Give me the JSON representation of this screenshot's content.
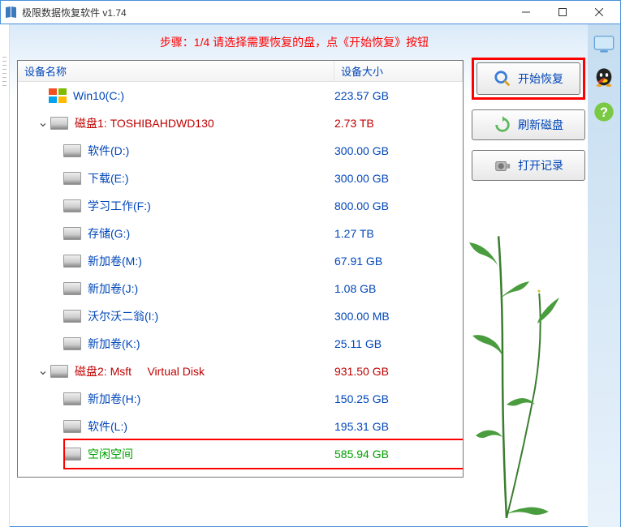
{
  "window": {
    "title": "极限数据恢复软件 v1.74"
  },
  "instruction": "步骤：1/4 请选择需要恢复的盘，点《开始恢复》按钮",
  "table": {
    "headers": {
      "name": "设备名称",
      "size": "设备大小"
    },
    "rows": [
      {
        "label": "Win10(C:)",
        "size": "223.57 GB",
        "color": "blue",
        "indent": 0,
        "icon": "win",
        "chevron": false
      },
      {
        "label": "磁盘1: TOSHIBAHDWD130",
        "size": "2.73 TB",
        "color": "red",
        "indent": 1,
        "icon": "disk",
        "chevron": true
      },
      {
        "label": "软件(D:)",
        "size": "300.00 GB",
        "color": "blue",
        "indent": 2,
        "icon": "disk",
        "chevron": false
      },
      {
        "label": "下载(E:)",
        "size": "300.00 GB",
        "color": "blue",
        "indent": 2,
        "icon": "disk",
        "chevron": false
      },
      {
        "label": "学习工作(F:)",
        "size": "800.00 GB",
        "color": "blue",
        "indent": 2,
        "icon": "disk",
        "chevron": false
      },
      {
        "label": "存储(G:)",
        "size": "1.27 TB",
        "color": "blue",
        "indent": 2,
        "icon": "disk",
        "chevron": false
      },
      {
        "label": "新加卷(M:)",
        "size": "67.91 GB",
        "color": "blue",
        "indent": 2,
        "icon": "disk",
        "chevron": false
      },
      {
        "label": "新加卷(J:)",
        "size": "1.08 GB",
        "color": "blue",
        "indent": 2,
        "icon": "disk",
        "chevron": false
      },
      {
        "label": "沃尔沃二翁(I:)",
        "size": "300.00 MB",
        "color": "blue",
        "indent": 2,
        "icon": "disk",
        "chevron": false
      },
      {
        "label": "新加卷(K:)",
        "size": "25.11 GB",
        "color": "blue",
        "indent": 2,
        "icon": "disk",
        "chevron": false
      },
      {
        "label": "磁盘2: Msft     Virtual Disk",
        "size": "931.50 GB",
        "color": "red",
        "indent": 1,
        "icon": "disk",
        "chevron": true
      },
      {
        "label": "新加卷(H:)",
        "size": "150.25 GB",
        "color": "blue",
        "indent": 2,
        "icon": "disk",
        "chevron": false
      },
      {
        "label": "软件(L:)",
        "size": "195.31 GB",
        "color": "blue",
        "indent": 2,
        "icon": "disk",
        "chevron": false
      },
      {
        "label": "空闲空间",
        "size": "585.94 GB",
        "color": "green",
        "indent": 2,
        "icon": "disk",
        "chevron": false,
        "highlight": true
      }
    ]
  },
  "buttons": {
    "start": "开始恢复",
    "refresh": "刷新磁盘",
    "open": "打开记录"
  }
}
